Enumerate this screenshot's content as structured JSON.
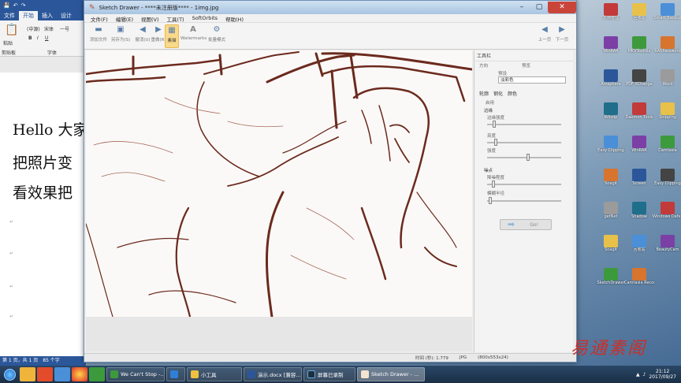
{
  "word": {
    "tabs": [
      "文件",
      "开始",
      "插入",
      "设计"
    ],
    "active_tab": 1,
    "font_name": "(中源)",
    "font_family": "宋体",
    "font_size": "一号",
    "group_clipboard": "剪贴板",
    "group_font": "字体",
    "paste_label": "粘贴",
    "lines": [
      "Hello 大家",
      "把照片变",
      "看效果把"
    ],
    "status": "第 1 页，共 1 页　85 个字"
  },
  "window": {
    "title": "Sketch Drawer - ****未注册版**** - 1img.jpg",
    "menu": [
      "文件(F)",
      "编辑(E)",
      "视图(V)",
      "工具(T)",
      "SoftOrbits",
      "帮助(H)"
    ],
    "toolbar": [
      {
        "name": "add-file",
        "label": "添加文件",
        "icon": "folder-icon"
      },
      {
        "name": "save-as",
        "label": "另存为(S)",
        "icon": "save-icon"
      },
      {
        "name": "undo",
        "label": "撤消(U)",
        "icon": "undo-icon"
      },
      {
        "name": "redo",
        "label": "重做(R)",
        "icon": "redo-icon"
      },
      {
        "name": "preview",
        "label": "素描",
        "icon": "image-icon"
      },
      {
        "name": "watermarks",
        "label": "Watermarks",
        "icon": "text-icon"
      },
      {
        "name": "bg-mode",
        "label": "批量模式",
        "icon": "gear-icon"
      }
    ],
    "nav": {
      "prev": "上一页",
      "next": "下一页"
    },
    "panel": {
      "title": "工具栏",
      "preset_label": "预设",
      "preset_tab1": "方向",
      "preset_tab2": "预览",
      "preset_value": "淡彩色",
      "tabs": [
        "轮廓",
        "钢化",
        "颜色"
      ],
      "checkbox_label": "启用",
      "section_edge": "边缘",
      "slider1_label": "边缘强度",
      "slider2_label": "亮度",
      "slider3_label": "强度",
      "section_noise": "噪点",
      "slider4_label": "降噪程度",
      "slider5_label": "模糊半径",
      "slider_values": [
        0.08,
        0.1,
        0.55,
        0.07,
        0.02
      ],
      "draw_button": "Go!"
    },
    "status": {
      "time": "时间 (秒): 1.779",
      "format": "JPG",
      "size": "(800x553x24)"
    },
    "progress": 0.16
  },
  "desktop_icons": [
    "文档管理",
    "回收站",
    "Smart Backup",
    "WinRAR",
    "MKVToolNix",
    "RARPassword",
    "Amsphere",
    "PDF XChange",
    "Word",
    "Winzip",
    "Daemon Tools",
    "Snipping",
    "Easy Clipping",
    "WinRAR",
    "Camtasia",
    "Snagit",
    "Screen",
    "Easy Clipping",
    "getNet",
    "Shadow",
    "Windows Defender",
    "Snagit",
    "回收站",
    "BeautyCam",
    "SketchDrawer",
    "Camtasia Recorder"
  ],
  "taskbar": {
    "tasks": [
      {
        "label": "We Can't Stop -..."
      },
      {
        "label": ""
      },
      {
        "label": "小工具"
      },
      {
        "label": "演示.docx [兼容..."
      },
      {
        "label": "屏幕已录制"
      },
      {
        "label": "Sketch Drawer - ..."
      }
    ],
    "time": "21:12",
    "date": "2017/09/27"
  },
  "watermark": "易通素阁"
}
